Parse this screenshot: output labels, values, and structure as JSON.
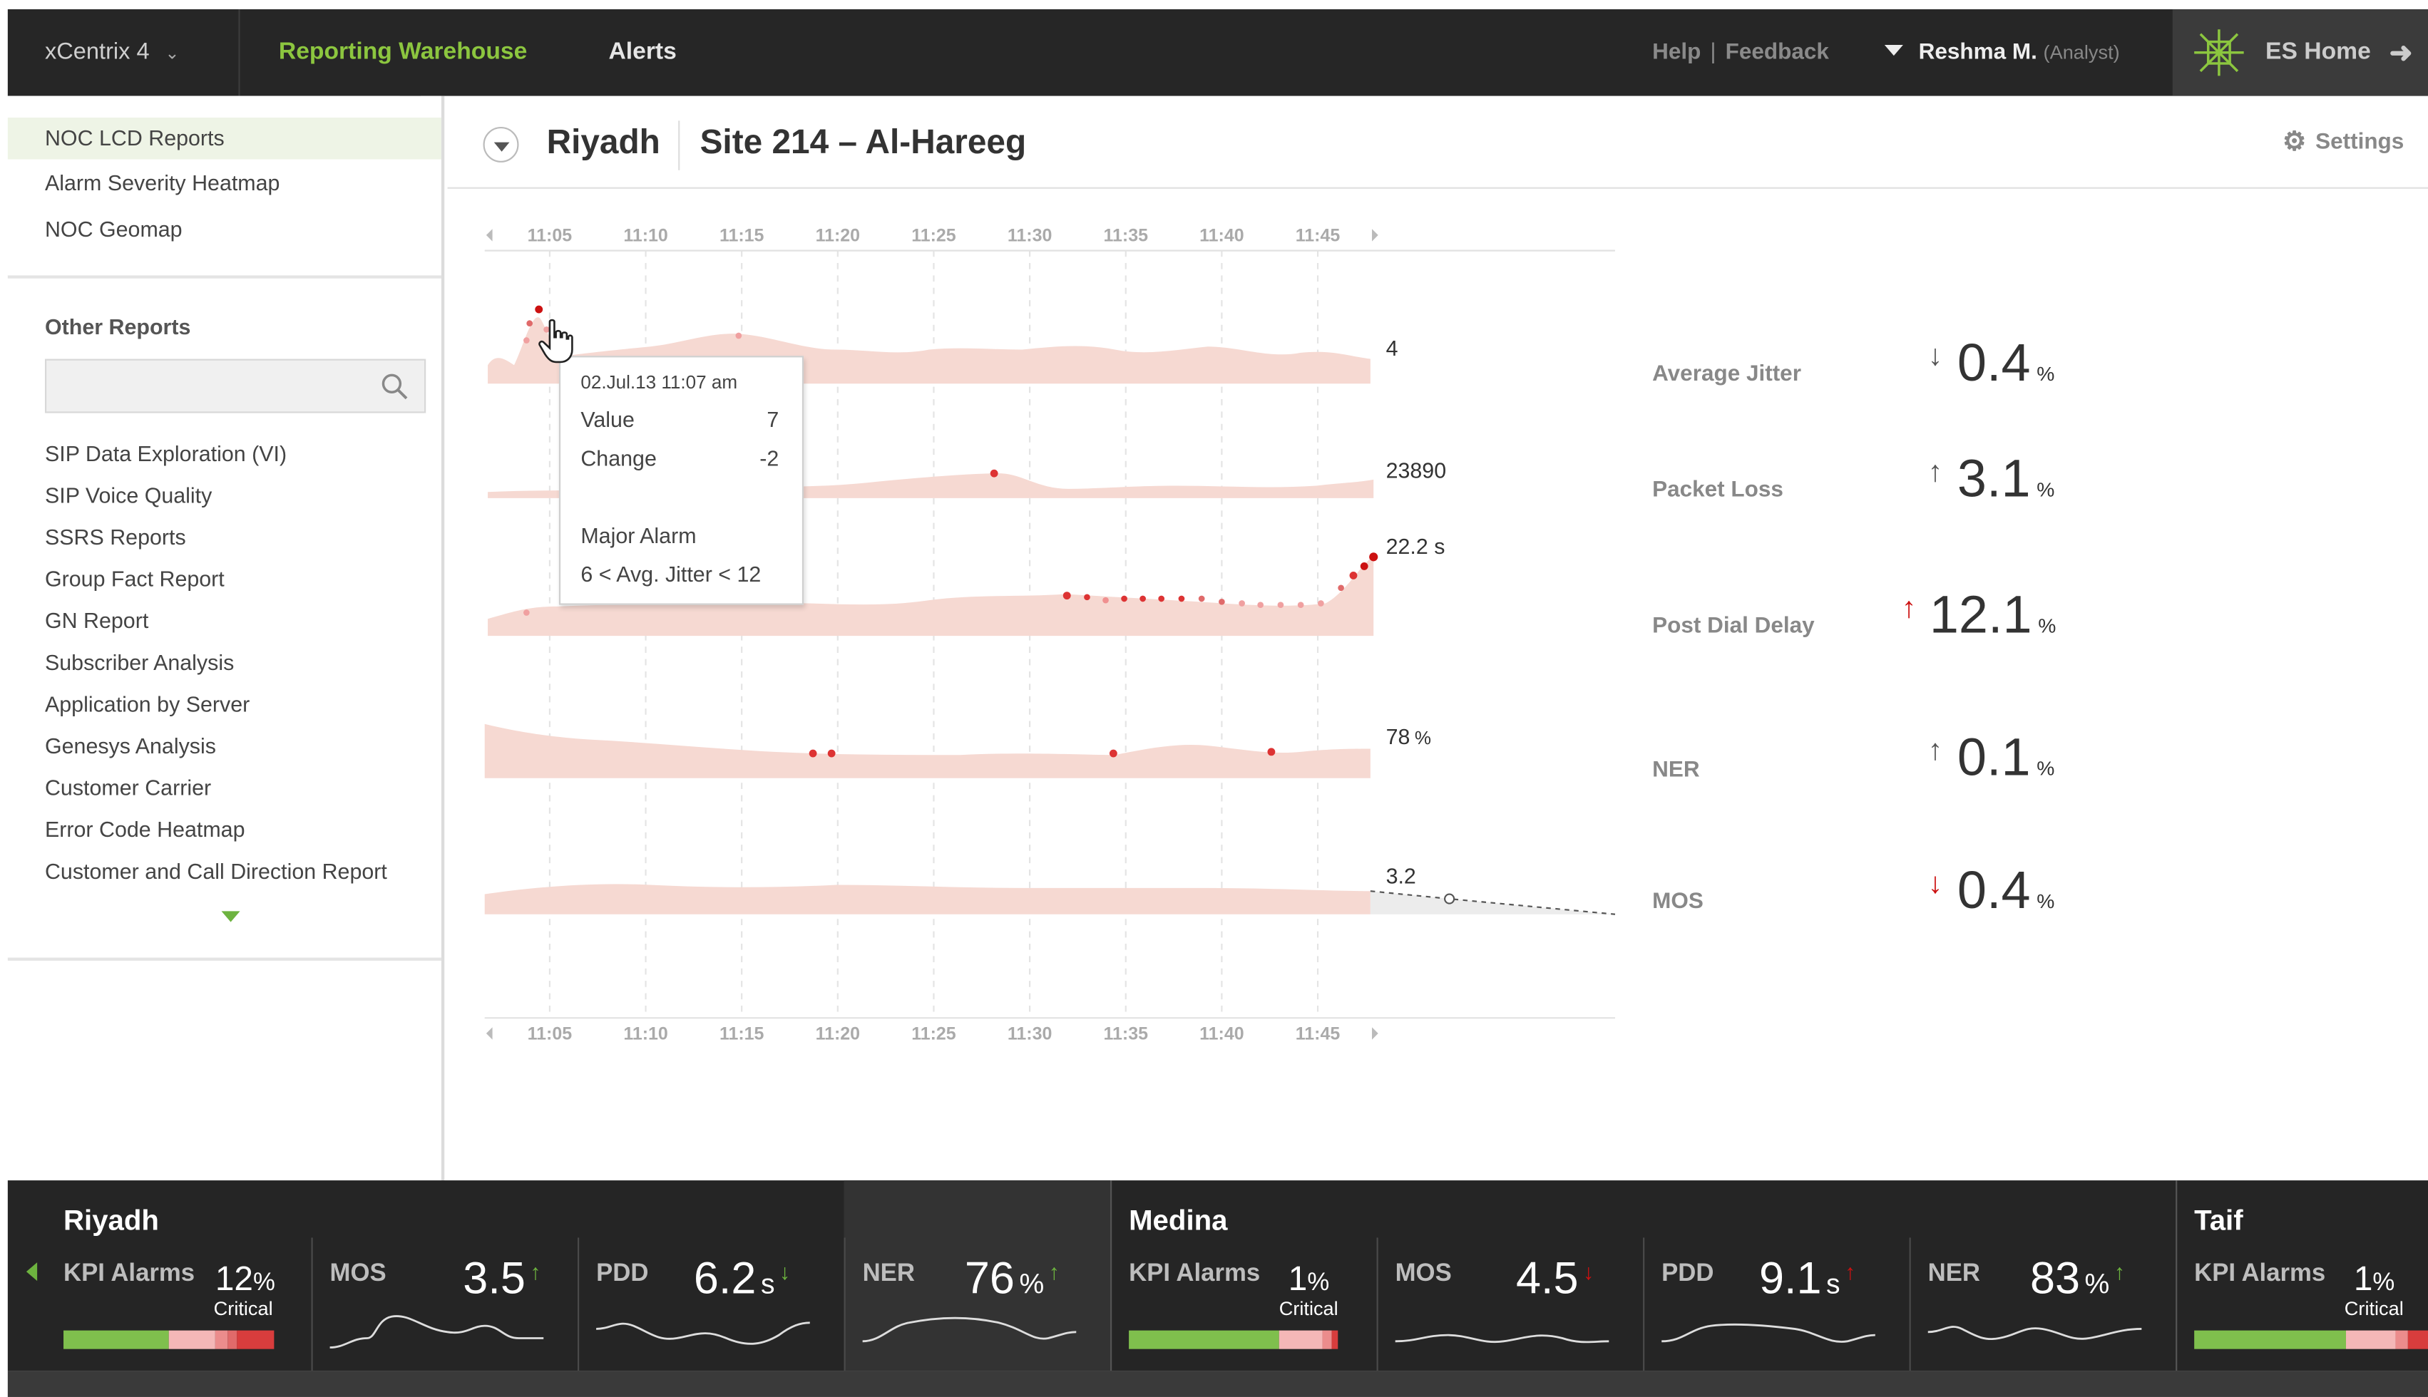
{
  "app": {
    "product": "xCentrix 4",
    "nav_active": "Reporting Warehouse",
    "nav_alerts": "Alerts"
  },
  "header": {
    "help": "Help",
    "sep": "|",
    "feedback": "Feedback",
    "user_name": "Reshma M.",
    "user_role": "(Analyst)",
    "es_home": "ES Home"
  },
  "sidebar": {
    "primary": [
      "NOC LCD Reports",
      "Alarm Severity Heatmap",
      "NOC Geomap"
    ],
    "other_title": "Other Reports",
    "search_placeholder": "",
    "reports": [
      "SIP Data Exploration (VI)",
      "SIP Voice Quality",
      "SSRS Reports",
      "Group Fact Report",
      "GN Report",
      "Subscriber Analysis",
      "Application by Server",
      "Genesys Analysis",
      "Customer Carrier",
      "Error Code Heatmap",
      "Customer and Call Direction Report"
    ]
  },
  "main": {
    "city": "Riyadh",
    "site": "Site 214 – Al-Hareeg",
    "settings": "Settings"
  },
  "time_axis": [
    "11:05",
    "11:10",
    "11:15",
    "11:20",
    "11:25",
    "11:30",
    "11:35",
    "11:40",
    "11:45"
  ],
  "chart_data": {
    "type": "area",
    "x": [
      "11:05",
      "11:10",
      "11:15",
      "11:20",
      "11:25",
      "11:30",
      "11:35",
      "11:40",
      "11:45"
    ],
    "series": [
      {
        "end_label": "4"
      },
      {
        "end_label": "23890"
      },
      {
        "end_label": "22.2 s"
      },
      {
        "end_label": "78",
        "end_unit": "%"
      },
      {
        "end_label": "3.2"
      }
    ]
  },
  "tooltip": {
    "timestamp": "02.Jul.13  11:07 am",
    "value_label": "Value",
    "value": "7",
    "change_label": "Change",
    "change": "-2",
    "alarm": "Major Alarm",
    "condition": "6 < Avg. Jitter < 12"
  },
  "kpis": [
    {
      "name": "Average Jitter",
      "value": "0.4",
      "unit": "%",
      "arrow": "↓",
      "color": "#555555"
    },
    {
      "name": "Packet Loss",
      "value": "3.1",
      "unit": "%",
      "arrow": "↑",
      "color": "#555555"
    },
    {
      "name": "Post Dial Delay",
      "value": "12.1",
      "unit": "%",
      "arrow": "↑",
      "color": "#cc1111"
    },
    {
      "name": "NER",
      "value": "0.1",
      "unit": "%",
      "arrow": "↑",
      "color": "#555555"
    },
    {
      "name": "MOS",
      "value": "0.4",
      "unit": "%",
      "arrow": "↓",
      "color": "#cc1111"
    }
  ],
  "bottom": {
    "riyadh": {
      "region": "Riyadh",
      "kpi_label": "KPI Alarms",
      "kpi_val": "12",
      "kpi_unit": "%",
      "critical": "Critical",
      "mos_label": "MOS",
      "mos_val": "3.5",
      "mos_arrow": "↑",
      "pdd_label": "PDD",
      "pdd_val": "6.2",
      "pdd_unit": "s",
      "pdd_arrow": "↓",
      "ner_label": "NER",
      "ner_val": "76",
      "ner_unit": "%",
      "ner_arrow": "↑"
    },
    "medina": {
      "region": "Medina",
      "kpi_label": "KPI Alarms",
      "kpi_val": "1",
      "kpi_unit": "%",
      "critical": "Critical",
      "mos_label": "MOS",
      "mos_val": "4.5",
      "mos_arrow": "↓",
      "pdd_label": "PDD",
      "pdd_val": "9.1",
      "pdd_unit": "s",
      "pdd_arrow": "↑",
      "ner_label": "NER",
      "ner_val": "83",
      "ner_unit": "%",
      "ner_arrow": "↑"
    },
    "taif": {
      "region": "Taif",
      "kpi_label": "KPI Alarms",
      "kpi_val": "1",
      "kpi_unit": "%",
      "critical": "Critical"
    }
  },
  "colors": {
    "accent": "#8cc63f",
    "up_green": "#6db33f",
    "down_red": "#cc1111",
    "area_fill": "#f6d9d2",
    "dark_bar": "#252525"
  }
}
